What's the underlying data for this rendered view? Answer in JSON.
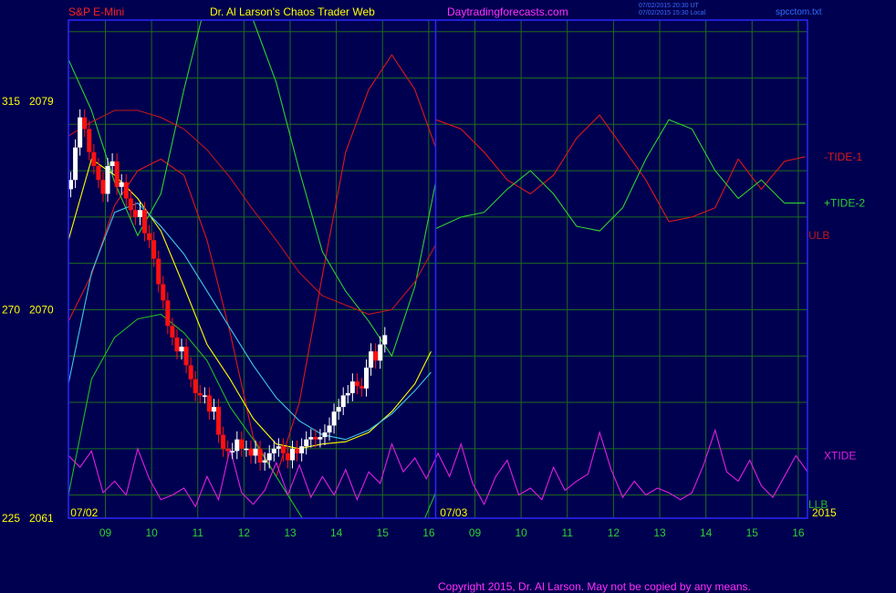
{
  "header": {
    "symbol": "S&P E-Mini",
    "title": "Dr. Al Larson's Chaos Trader Web",
    "site": "Daytradingforecasts.com",
    "stamp_ut": "07/02/2015 20:30 UT",
    "stamp_local": "07/02/2015 15:30 Local",
    "file": "spcctom.txt"
  },
  "footer": {
    "copyright": "Copyright 2015, Dr. Al Larson. May not be copied by any means."
  },
  "colors": {
    "background": "#000050",
    "frame": "#2828ff",
    "grid": "#1e6a1e",
    "price_up": "#ffffff",
    "price_down": "#ff1010",
    "tide1": "#e01818",
    "tide2": "#30d030",
    "xtide": "#e020e0",
    "ulb": "#c01818",
    "llb": "#22bb22",
    "ma_yellow": "#ffff00",
    "ma_cyan": "#40c8e8",
    "header_symbol": "#ff2020",
    "header_title": "#ffff00",
    "header_site": "#ff30ff",
    "stamp": "#3a6cff",
    "file_label": "#2f6cff",
    "time_label": "#30d030",
    "price_label": "#ffff00",
    "footer_text": "#ff30ff"
  },
  "chart_data": {
    "type": "line",
    "title": "S&P E-Mini",
    "y_axis_labels": [
      {
        "left": "315",
        "right": "2079"
      },
      {
        "left": "270",
        "right": "2070"
      },
      {
        "left": "225",
        "right": "2061"
      }
    ],
    "ylim": [
      2061,
      2082.5
    ],
    "xlim": [
      8.0,
      24.0
    ],
    "x_tick_labels": [
      "09",
      "10",
      "11",
      "12",
      "13",
      "14",
      "15",
      "16",
      "09",
      "10",
      "11",
      "12",
      "13",
      "14",
      "15",
      "16"
    ],
    "x_tick_values": [
      8.8,
      9.8,
      10.8,
      11.8,
      12.8,
      13.8,
      14.8,
      15.8,
      16.8,
      17.8,
      18.8,
      19.8,
      20.8,
      21.8,
      22.8,
      23.8
    ],
    "date_labels": [
      {
        "text": "07/02",
        "x": 8.4
      },
      {
        "text": "07/03",
        "x": 16.4
      }
    ],
    "year_label": "2015",
    "divider_x": 15.95,
    "price_series": {
      "name": "S&P E-Mini",
      "x": [
        8.05,
        8.15,
        8.25,
        8.35,
        8.45,
        8.55,
        8.65,
        8.75,
        8.85,
        8.95,
        9.05,
        9.15,
        9.25,
        9.35,
        9.45,
        9.55,
        9.65,
        9.75,
        9.85,
        9.95,
        10.05,
        10.15,
        10.25,
        10.35,
        10.45,
        10.55,
        10.65,
        10.75,
        10.85,
        10.95,
        11.05,
        11.15,
        11.25,
        11.35,
        11.45,
        11.55,
        11.65,
        11.75,
        11.85,
        11.95,
        12.05,
        12.15,
        12.25,
        12.35,
        12.45,
        12.55,
        12.65,
        12.75,
        12.85,
        12.95,
        13.05,
        13.15,
        13.25,
        13.35,
        13.45,
        13.55,
        13.65,
        13.75,
        13.85,
        13.95,
        14.05,
        14.15,
        14.25,
        14.35,
        14.45,
        14.55,
        14.65,
        14.75,
        14.85,
        14.95,
        15.05,
        15.15,
        15.25,
        15.35,
        15.45,
        15.55,
        15.65,
        15.75,
        15.85
      ],
      "open": [
        2075.2,
        2075.6,
        2077.0,
        2078.3,
        2077.8,
        2076.8,
        2076.2,
        2075.6,
        2075.0,
        2076.2,
        2076.4,
        2075.3,
        2075.5,
        2074.8,
        2074.3,
        2074.0,
        2074.3,
        2073.3,
        2073.0,
        2072.2,
        2071.1,
        2070.4,
        2069.3,
        2068.8,
        2068.2,
        2068.4,
        2067.6,
        2067.0,
        2066.4,
        2066.3,
        2066.3,
        2065.6,
        2065.8,
        2064.6,
        2064.0,
        2063.9,
        2063.9,
        2064.4,
        2064.0,
        2064.0,
        2063.7,
        2064.0,
        2063.4,
        2063.5,
        2063.8,
        2064.0,
        2064.1,
        2063.8,
        2063.5,
        2064.0,
        2063.8,
        2064.1,
        2064.4,
        2064.5,
        2064.4,
        2064.5,
        2064.7,
        2065.0,
        2065.6,
        2065.8,
        2066.3,
        2066.4,
        2066.9,
        2066.7,
        2066.6,
        2067.5,
        2068.2,
        2067.8,
        2068.5
      ],
      "close": [
        2075.6,
        2077.0,
        2078.3,
        2077.8,
        2076.8,
        2076.2,
        2075.6,
        2075.0,
        2076.2,
        2076.4,
        2075.3,
        2075.5,
        2074.8,
        2074.3,
        2074.0,
        2074.3,
        2073.3,
        2073.0,
        2072.2,
        2071.1,
        2070.4,
        2069.3,
        2068.8,
        2068.2,
        2068.4,
        2067.6,
        2067.0,
        2066.4,
        2066.3,
        2066.3,
        2065.6,
        2065.8,
        2064.6,
        2064.0,
        2063.9,
        2063.9,
        2064.4,
        2064.0,
        2064.0,
        2063.7,
        2064.0,
        2063.4,
        2063.5,
        2063.8,
        2064.0,
        2064.1,
        2063.8,
        2063.5,
        2064.0,
        2063.8,
        2064.1,
        2064.4,
        2064.5,
        2064.4,
        2064.5,
        2064.7,
        2065.0,
        2065.6,
        2065.8,
        2066.3,
        2066.4,
        2066.9,
        2066.7,
        2066.6,
        2067.5,
        2068.2,
        2067.8,
        2068.5,
        2068.9
      ]
    },
    "series": [
      {
        "name": "-TIDE-1",
        "color_key": "tide1",
        "x": [
          8.0,
          8.5,
          9.0,
          9.5,
          10.0,
          10.5,
          11.0,
          11.5,
          12.0,
          12.5,
          13.0,
          13.5,
          14.0,
          14.5,
          15.0,
          15.5,
          15.95
        ],
        "y": [
          2069.5,
          2071.5,
          2074.5,
          2076.0,
          2076.5,
          2075.8,
          2073.0,
          2069.0,
          2064.5,
          2062.8,
          2066.0,
          2071.5,
          2076.8,
          2079.5,
          2081.0,
          2079.5,
          2077.0
        ]
      },
      {
        "name": "-TIDE-1",
        "color_key": "tide1",
        "x": [
          15.95,
          16.5,
          17.0,
          17.5,
          18.0,
          18.5,
          19.0,
          19.5,
          20.0,
          20.5,
          21.0,
          21.5,
          22.0,
          22.5,
          23.0,
          23.5,
          23.95
        ],
        "y": [
          2078.2,
          2077.8,
          2076.8,
          2075.6,
          2075.0,
          2075.8,
          2077.4,
          2078.4,
          2077.0,
          2075.6,
          2073.8,
          2074.0,
          2074.4,
          2076.5,
          2075.2,
          2076.4,
          2076.6
        ]
      },
      {
        "name": "+TIDE-2",
        "color_key": "tide2",
        "x": [
          8.0,
          8.5,
          9.0,
          9.5,
          10.0,
          10.5,
          11.0,
          11.5,
          12.0,
          12.5,
          13.0,
          13.5,
          14.0,
          14.5,
          15.0,
          15.5,
          15.95
        ],
        "y": [
          2080.8,
          2078.6,
          2075.5,
          2073.2,
          2075.0,
          2079.5,
          2083.5,
          2084.5,
          2082.5,
          2079.8,
          2076.0,
          2072.5,
          2070.8,
          2069.5,
          2068.0,
          2071.0,
          2075.5
        ]
      },
      {
        "name": "+TIDE-2",
        "color_key": "tide2",
        "x": [
          15.95,
          16.5,
          17.0,
          17.5,
          18.0,
          18.5,
          19.0,
          19.5,
          20.0,
          20.5,
          21.0,
          21.5,
          22.0,
          22.5,
          23.0,
          23.5,
          23.95
        ],
        "y": [
          2073.5,
          2074.0,
          2074.2,
          2075.2,
          2076.0,
          2075.0,
          2073.6,
          2073.4,
          2074.4,
          2076.5,
          2078.2,
          2077.8,
          2076.0,
          2074.8,
          2075.6,
          2074.6,
          2074.6
        ]
      },
      {
        "name": "ULB",
        "color_key": "ulb",
        "x": [
          8.0,
          8.5,
          9.0,
          9.5,
          10.0,
          10.5,
          11.0,
          11.5,
          12.0,
          12.5,
          13.0,
          13.5,
          14.0,
          14.5,
          15.0,
          15.5,
          15.95
        ],
        "y": [
          2077.5,
          2078.1,
          2078.6,
          2078.6,
          2078.3,
          2077.8,
          2076.9,
          2075.7,
          2074.3,
          2073.0,
          2071.6,
          2070.6,
          2070.2,
          2069.8,
          2070.0,
          2071.2,
          2072.8
        ]
      },
      {
        "name": "LLB",
        "color_key": "llb",
        "x": [
          8.0,
          8.5,
          9.0,
          9.5,
          10.0,
          10.5,
          11.0,
          11.5,
          12.0,
          12.5,
          13.0,
          13.5,
          14.0,
          14.5,
          15.0,
          15.5,
          15.95
        ],
        "y": [
          2062.0,
          2067.0,
          2068.8,
          2069.6,
          2069.8,
          2069.0,
          2067.8,
          2065.8,
          2064.4,
          2062.8,
          2061.2,
          2059.6,
          2058.0,
          2057.5,
          2058.0,
          2060.0,
          2062.1
        ]
      },
      {
        "name": "Avg-Yellow",
        "color_key": "ma_yellow",
        "x": [
          8.0,
          8.5,
          9.0,
          9.5,
          10.0,
          10.5,
          11.0,
          11.5,
          12.0,
          12.5,
          13.0,
          13.5,
          14.0,
          14.5,
          15.0,
          15.5,
          15.85
        ],
        "y": [
          2073.0,
          2076.5,
          2075.8,
          2074.8,
          2073.4,
          2071.0,
          2068.5,
          2067.0,
          2065.3,
          2064.2,
          2064.0,
          2064.2,
          2064.3,
          2064.7,
          2065.6,
          2066.8,
          2068.2
        ]
      },
      {
        "name": "Avg-Cyan",
        "color_key": "ma_cyan",
        "x": [
          8.0,
          8.5,
          9.0,
          9.5,
          10.0,
          10.5,
          11.0,
          11.5,
          12.0,
          12.5,
          13.0,
          13.5,
          14.0,
          14.5,
          15.0,
          15.5,
          15.85
        ],
        "y": [
          2066.8,
          2071.6,
          2074.2,
          2074.6,
          2073.6,
          2072.4,
          2070.8,
          2069.2,
          2067.6,
          2066.2,
          2065.2,
          2064.6,
          2064.4,
          2064.8,
          2065.5,
          2066.5,
          2067.3
        ]
      },
      {
        "name": "XTIDE",
        "color_key": "xtide",
        "x": [
          8.0,
          8.25,
          8.5,
          8.75,
          9.0,
          9.25,
          9.5,
          9.75,
          10.0,
          10.25,
          10.5,
          10.75,
          11.0,
          11.25,
          11.5,
          11.75,
          12.0,
          12.25,
          12.5,
          12.75,
          13.0,
          13.25,
          13.5,
          13.75,
          14.0,
          14.25,
          14.5,
          14.75,
          15.0,
          15.25,
          15.5,
          15.75,
          16.0,
          16.25,
          16.5,
          16.75,
          17.0,
          17.25,
          17.5,
          17.75,
          18.0,
          18.25,
          18.5,
          18.75,
          19.0,
          19.25,
          19.5,
          19.75,
          20.0,
          20.25,
          20.5,
          20.75,
          21.0,
          21.25,
          21.5,
          21.75,
          22.0,
          22.25,
          22.5,
          22.75,
          23.0,
          23.25,
          23.5,
          23.75,
          24.0
        ],
        "y": [
          2063.7,
          2063.2,
          2063.9,
          2062.1,
          2062.6,
          2062.0,
          2064.0,
          2062.7,
          2061.8,
          2062.0,
          2062.3,
          2061.5,
          2062.8,
          2061.8,
          2064.0,
          2062.1,
          2061.6,
          2062.2,
          2063.4,
          2062.0,
          2063.3,
          2061.9,
          2062.8,
          2062.0,
          2063.1,
          2061.8,
          2063.0,
          2062.5,
          2064.2,
          2063.0,
          2063.6,
          2062.7,
          2063.8,
          2062.8,
          2064.2,
          2062.5,
          2061.6,
          2062.8,
          2063.5,
          2062.0,
          2062.3,
          2061.8,
          2063.2,
          2062.2,
          2062.6,
          2062.9,
          2064.7,
          2063.1,
          2061.9,
          2062.6,
          2062.0,
          2062.3,
          2062.1,
          2061.8,
          2062.1,
          2063.3,
          2064.8,
          2063.0,
          2062.6,
          2063.5,
          2062.4,
          2061.9,
          2062.8,
          2063.7,
          2063.0
        ]
      }
    ],
    "series_labels": [
      {
        "name": "-TIDE-1",
        "y": 2076.6
      },
      {
        "name": "+TIDE-2",
        "y": 2074.6
      },
      {
        "name": "ULB",
        "y": 2073.2
      },
      {
        "name": "XTIDE",
        "y": 2063.7
      },
      {
        "name": "LLB",
        "y": 2061.6
      }
    ]
  }
}
